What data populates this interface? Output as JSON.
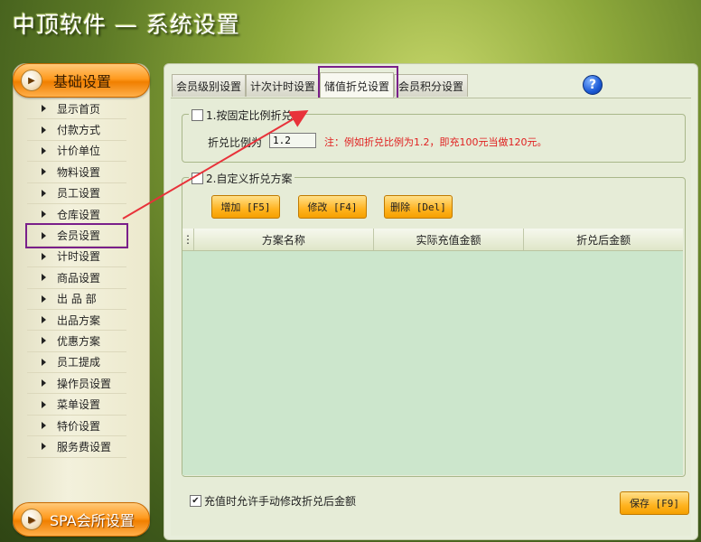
{
  "window": {
    "title": "中顶软件 — 系统设置"
  },
  "sidebar": {
    "section_top": "基础设置",
    "section_bottom": "SPA会所设置",
    "items": [
      {
        "label": "显示首页"
      },
      {
        "label": "付款方式"
      },
      {
        "label": "计价单位"
      },
      {
        "label": "物料设置"
      },
      {
        "label": "员工设置"
      },
      {
        "label": "仓库设置"
      },
      {
        "label": "会员设置"
      },
      {
        "label": "计时设置"
      },
      {
        "label": "商品设置"
      },
      {
        "label": "出 品 部"
      },
      {
        "label": "出品方案"
      },
      {
        "label": "优惠方案"
      },
      {
        "label": "员工提成"
      },
      {
        "label": "操作员设置"
      },
      {
        "label": "菜单设置"
      },
      {
        "label": "特价设置"
      },
      {
        "label": "服务费设置"
      }
    ],
    "highlighted_item": "会员设置"
  },
  "tabs": [
    {
      "label": "会员级别设置"
    },
    {
      "label": "计次计时设置"
    },
    {
      "label": "储值折兑设置",
      "active": true
    },
    {
      "label": "会员积分设置"
    }
  ],
  "help_icon": "question-icon",
  "fixed_ratio": {
    "group_label": "1.按固定比例折兑",
    "checked": false,
    "ratio_label": "折兑比例为",
    "ratio_value": "1.2",
    "note": "注：例如折兑比例为1.2，即充100元当做120元。"
  },
  "custom_scheme": {
    "group_label": "2.自定义折兑方案",
    "checked": false,
    "buttons": {
      "add": "增加 [F5]",
      "edit": "修改 [F4]",
      "delete": "删除 [Del]"
    },
    "columns": [
      "方案名称",
      "实际充值金额",
      "折兑后金额"
    ],
    "rows": []
  },
  "allow_manual_edit": {
    "label": "充值时允许手动修改折兑后金额",
    "checked": true
  },
  "save_button": "保存 [F9]",
  "colors": {
    "annotation": "#7a1f8a",
    "arrow": "#e8323a",
    "note_text": "#e02020",
    "grid_body": "#cce6cc",
    "orange_button": "#ffb320"
  }
}
